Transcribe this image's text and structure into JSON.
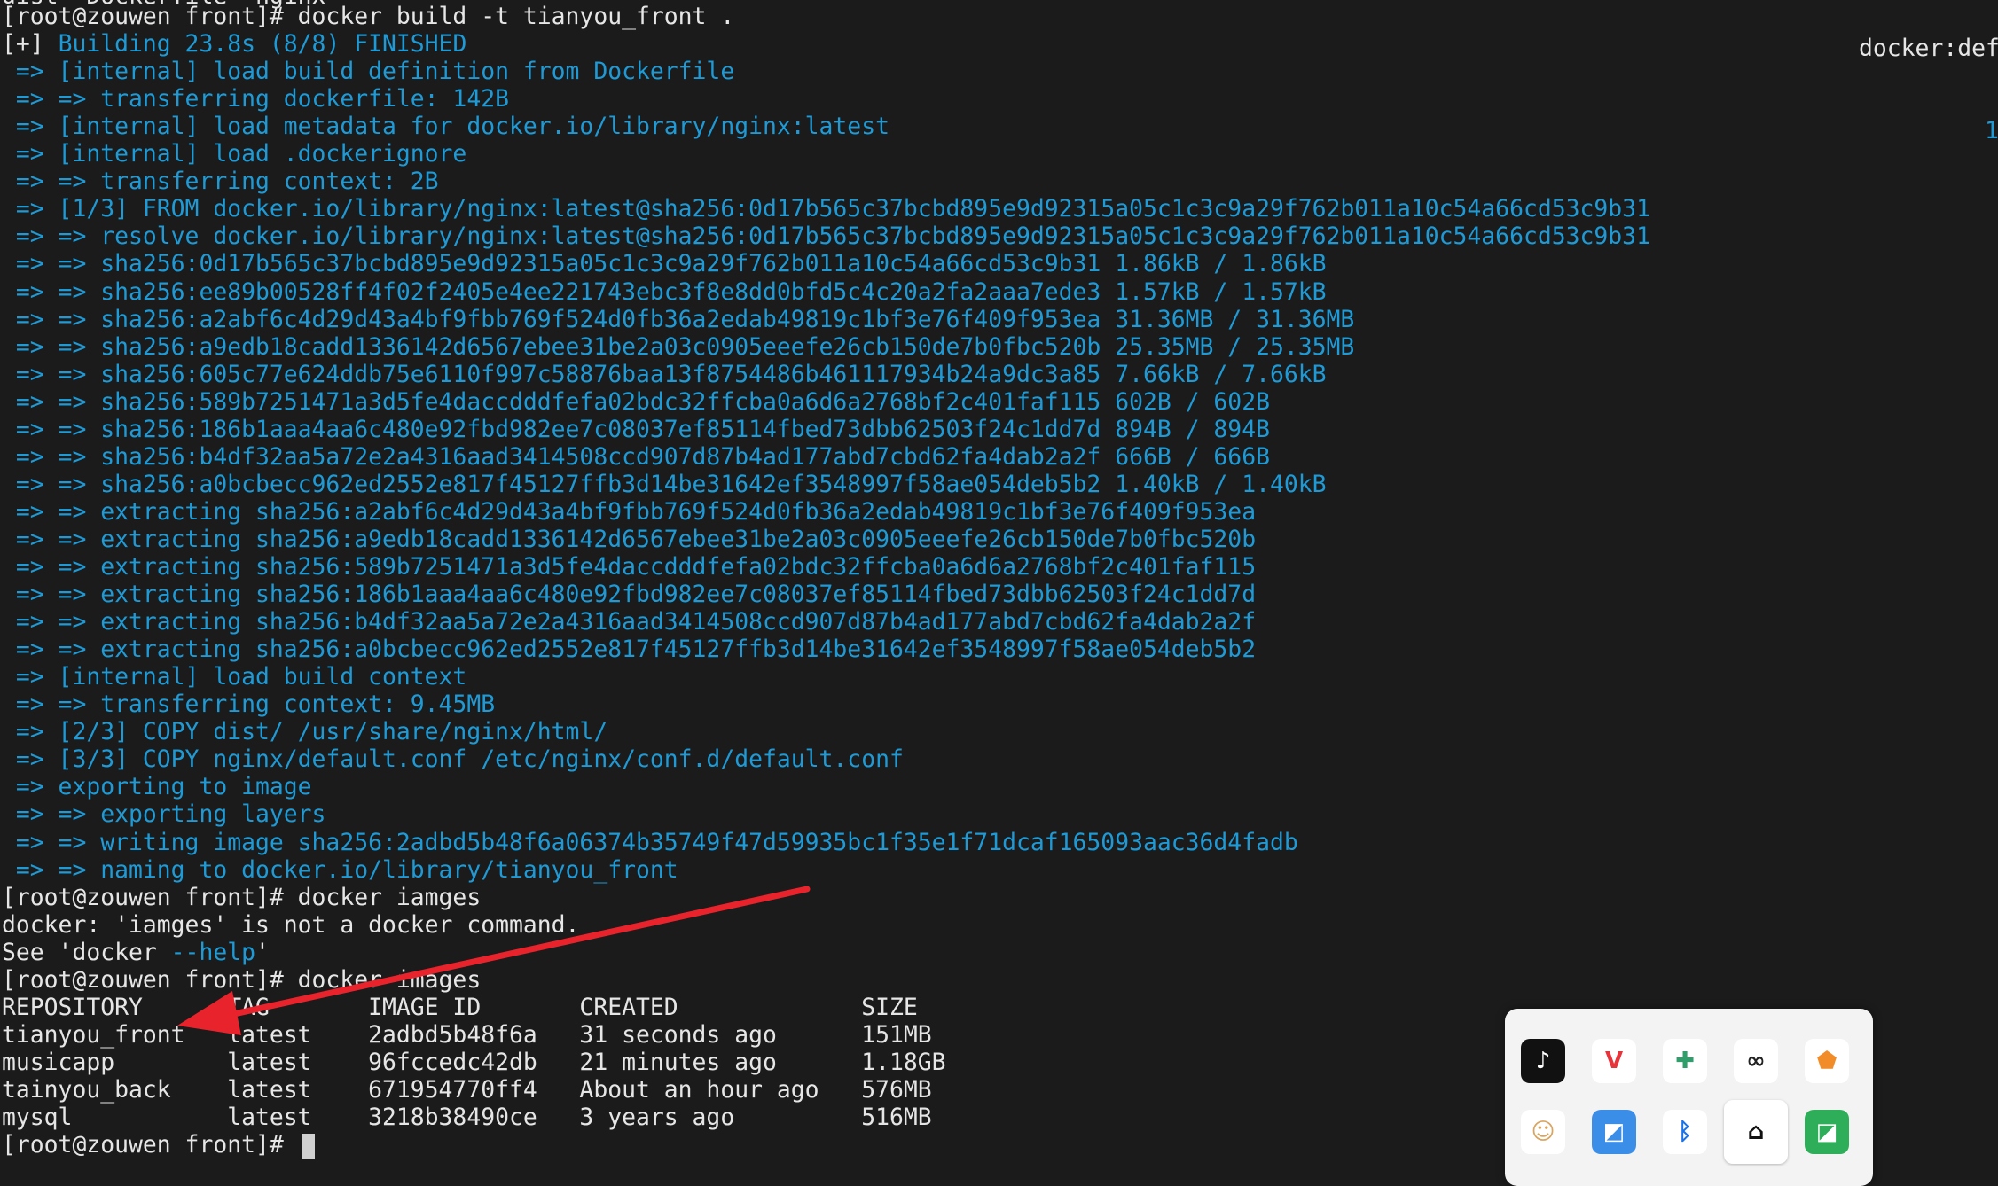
{
  "terminal": {
    "top_cut": "dist  Dockerfile  nginx",
    "right_note": "docker:def",
    "right_num": "1",
    "lines": [
      {
        "text": "[root@zouwen front]# docker build -t tianyou_front .",
        "style": "white"
      },
      {
        "text": "[+] Building 23.8s (8/8) FINISHED",
        "style": "mixed"
      },
      {
        "text": " => [internal] load build definition from Dockerfile",
        "style": "blue"
      },
      {
        "text": " => => transferring dockerfile: 142B",
        "style": "blue"
      },
      {
        "text": " => [internal] load metadata for docker.io/library/nginx:latest",
        "style": "blue"
      },
      {
        "text": " => [internal] load .dockerignore",
        "style": "blue"
      },
      {
        "text": " => => transferring context: 2B",
        "style": "blue"
      },
      {
        "text": " => [1/3] FROM docker.io/library/nginx:latest@sha256:0d17b565c37bcbd895e9d92315a05c1c3c9a29f762b011a10c54a66cd53c9b31",
        "style": "blue"
      },
      {
        "text": " => => resolve docker.io/library/nginx:latest@sha256:0d17b565c37bcbd895e9d92315a05c1c3c9a29f762b011a10c54a66cd53c9b31",
        "style": "blue"
      },
      {
        "text": " => => sha256:0d17b565c37bcbd895e9d92315a05c1c3c9a29f762b011a10c54a66cd53c9b31 1.86kB / 1.86kB",
        "style": "blue"
      },
      {
        "text": " => => sha256:ee89b00528ff4f02f2405e4ee221743ebc3f8e8dd0bfd5c4c20a2fa2aaa7ede3 1.57kB / 1.57kB",
        "style": "blue"
      },
      {
        "text": " => => sha256:a2abf6c4d29d43a4bf9fbb769f524d0fb36a2edab49819c1bf3e76f409f953ea 31.36MB / 31.36MB",
        "style": "blue"
      },
      {
        "text": " => => sha256:a9edb18cadd1336142d6567ebee31be2a03c0905eeefe26cb150de7b0fbc520b 25.35MB / 25.35MB",
        "style": "blue"
      },
      {
        "text": " => => sha256:605c77e624ddb75e6110f997c58876baa13f8754486b461117934b24a9dc3a85 7.66kB / 7.66kB",
        "style": "blue"
      },
      {
        "text": " => => sha256:589b7251471a3d5fe4daccdddfefa02bdc32ffcba0a6d6a2768bf2c401faf115 602B / 602B",
        "style": "blue"
      },
      {
        "text": " => => sha256:186b1aaa4aa6c480e92fbd982ee7c08037ef85114fbed73dbb62503f24c1dd7d 894B / 894B",
        "style": "blue"
      },
      {
        "text": " => => sha256:b4df32aa5a72e2a4316aad3414508ccd907d87b4ad177abd7cbd62fa4dab2a2f 666B / 666B",
        "style": "blue"
      },
      {
        "text": " => => sha256:a0bcbecc962ed2552e817f45127ffb3d14be31642ef3548997f58ae054deb5b2 1.40kB / 1.40kB",
        "style": "blue"
      },
      {
        "text": " => => extracting sha256:a2abf6c4d29d43a4bf9fbb769f524d0fb36a2edab49819c1bf3e76f409f953ea",
        "style": "blue"
      },
      {
        "text": " => => extracting sha256:a9edb18cadd1336142d6567ebee31be2a03c0905eeefe26cb150de7b0fbc520b",
        "style": "blue"
      },
      {
        "text": " => => extracting sha256:589b7251471a3d5fe4daccdddfefa02bdc32ffcba0a6d6a2768bf2c401faf115",
        "style": "blue"
      },
      {
        "text": " => => extracting sha256:186b1aaa4aa6c480e92fbd982ee7c08037ef85114fbed73dbb62503f24c1dd7d",
        "style": "blue"
      },
      {
        "text": " => => extracting sha256:b4df32aa5a72e2a4316aad3414508ccd907d87b4ad177abd7cbd62fa4dab2a2f",
        "style": "blue"
      },
      {
        "text": " => => extracting sha256:a0bcbecc962ed2552e817f45127ffb3d14be31642ef3548997f58ae054deb5b2",
        "style": "blue"
      },
      {
        "text": " => [internal] load build context",
        "style": "blue"
      },
      {
        "text": " => => transferring context: 9.45MB",
        "style": "blue"
      },
      {
        "text": " => [2/3] COPY dist/ /usr/share/nginx/html/",
        "style": "blue"
      },
      {
        "text": " => [3/3] COPY nginx/default.conf /etc/nginx/conf.d/default.conf",
        "style": "blue"
      },
      {
        "text": " => exporting to image",
        "style": "blue"
      },
      {
        "text": " => => exporting layers",
        "style": "blue"
      },
      {
        "text": " => => writing image sha256:2adbd5b48f6a06374b35749f47d59935bc1f35e1f71dcaf165093aac36d4fadb",
        "style": "blue"
      },
      {
        "text": " => => naming to docker.io/library/tianyou_front",
        "style": "blue"
      },
      {
        "text": "[root@zouwen front]# docker iamges",
        "style": "white"
      },
      {
        "text": "docker: 'iamges' is not a docker command.",
        "style": "white"
      },
      {
        "text": "See 'docker --help'",
        "style": "help"
      },
      {
        "text": "[root@zouwen front]# docker images",
        "style": "white"
      },
      {
        "text": "REPOSITORY      TAG       IMAGE ID       CREATED             SIZE",
        "style": "white"
      },
      {
        "text": "tianyou_front   latest    2adbd5b48f6a   31 seconds ago      151MB",
        "style": "white"
      },
      {
        "text": "musicapp        latest    96fccedc42db   21 minutes ago      1.18GB",
        "style": "white"
      },
      {
        "text": "tainyou_back    latest    671954770ff4   About an hour ago   576MB",
        "style": "white"
      },
      {
        "text": "mysql           latest    3218b38490ce   3 years ago         516MB",
        "style": "white"
      },
      {
        "text": "[root@zouwen front]# ",
        "style": "prompt"
      }
    ]
  },
  "tray": {
    "icons": [
      {
        "name": "tiktok-icon",
        "glyph": "♪",
        "bg": "#111111",
        "fg": "#ffffff"
      },
      {
        "name": "wps-icon",
        "glyph": "V",
        "bg": "#ffffff",
        "fg": "#e8333a"
      },
      {
        "name": "puzzle-app-icon",
        "glyph": "✚",
        "bg": "#ffffff",
        "fg": "#2f9e6a"
      },
      {
        "name": "creative-cloud-icon",
        "glyph": "∞",
        "bg": "#ffffff",
        "fg": "#222222"
      },
      {
        "name": "security-shield-icon",
        "glyph": "⬟",
        "bg": "#ffffff",
        "fg": "#f28c28"
      },
      {
        "name": "cat-app-icon",
        "glyph": "☺",
        "bg": "#ffffff",
        "fg": "#d9a45e"
      },
      {
        "name": "screenshot-app-icon",
        "glyph": "◩",
        "bg": "#3b8ee8",
        "fg": "#ffffff"
      },
      {
        "name": "bluetooth-icon",
        "glyph": "ᛒ",
        "bg": "#ffffff",
        "fg": "#1a73e8"
      },
      {
        "name": "bookmark-app-icon",
        "glyph": "⌂",
        "bg": "#ffffff",
        "fg": "#111111"
      },
      {
        "name": "green-app-icon",
        "glyph": "◪",
        "bg": "#2fae5a",
        "fg": "#ffffff"
      }
    ]
  }
}
